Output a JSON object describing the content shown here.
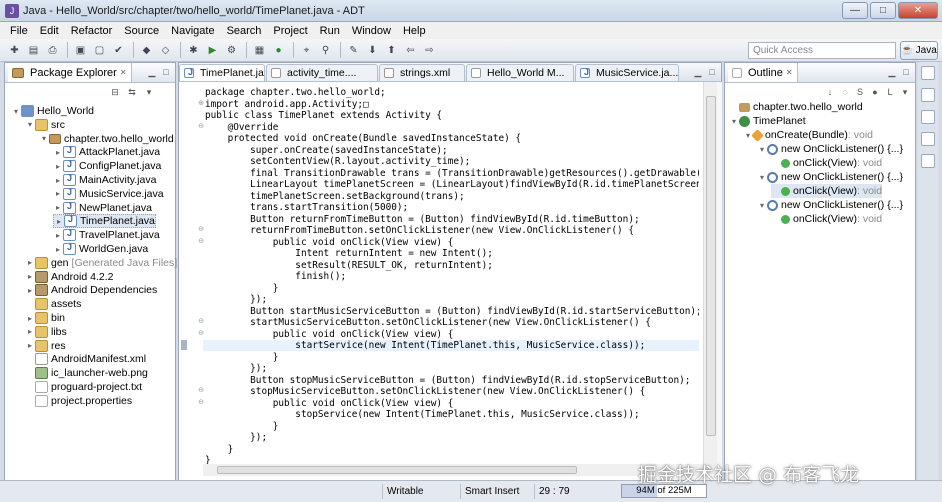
{
  "window": {
    "title": "Java - Hello_World/src/chapter/two/hello_world/TimePlanet.java - ADT",
    "buttons": [
      "—",
      "□",
      "✕"
    ]
  },
  "menu": [
    "File",
    "Edit",
    "Refactor",
    "Source",
    "Navigate",
    "Search",
    "Project",
    "Run",
    "Window",
    "Help"
  ],
  "toolbar": {
    "quick_access_placeholder": "Quick Access",
    "perspective": "Java"
  },
  "package_explorer": {
    "title": "Package Explorer",
    "items": [
      {
        "label": "Hello_World",
        "icon": "project-icon",
        "level": 0,
        "twist": "▾"
      },
      {
        "label": "src",
        "icon": "folder-icon",
        "level": 1,
        "twist": "▾"
      },
      {
        "label": "chapter.two.hello_world",
        "icon": "package-icon",
        "level": 2,
        "twist": "▾"
      },
      {
        "label": "AttackPlanet.java",
        "icon": "java-file-icon",
        "level": 3,
        "twist": "▸"
      },
      {
        "label": "ConfigPlanet.java",
        "icon": "java-file-icon",
        "level": 3,
        "twist": "▸"
      },
      {
        "label": "MainActivity.java",
        "icon": "java-file-icon",
        "level": 3,
        "twist": "▸"
      },
      {
        "label": "MusicService.java",
        "icon": "java-file-icon",
        "level": 3,
        "twist": "▸"
      },
      {
        "label": "NewPlanet.java",
        "icon": "java-file-icon",
        "level": 3,
        "twist": "▸"
      },
      {
        "label": "TimePlanet.java",
        "icon": "java-file-icon",
        "level": 3,
        "twist": "▸",
        "selected": true
      },
      {
        "label": "TravelPlanet.java",
        "icon": "java-file-icon",
        "level": 3,
        "twist": "▸"
      },
      {
        "label": "WorldGen.java",
        "icon": "java-file-icon",
        "level": 3,
        "twist": "▸"
      },
      {
        "label": "gen",
        "suffix": "[Generated Java Files]",
        "icon": "folder-icon",
        "level": 1,
        "twist": "▸"
      },
      {
        "label": "Android 4.2.2",
        "icon": "library-icon",
        "level": 1,
        "twist": "▸"
      },
      {
        "label": "Android Dependencies",
        "icon": "library-icon",
        "level": 1,
        "twist": "▸"
      },
      {
        "label": "assets",
        "icon": "folder-icon",
        "level": 1,
        "twist": ""
      },
      {
        "label": "bin",
        "icon": "folder-icon",
        "level": 1,
        "twist": "▸"
      },
      {
        "label": "libs",
        "icon": "folder-icon",
        "level": 1,
        "twist": "▸"
      },
      {
        "label": "res",
        "icon": "folder-icon",
        "level": 1,
        "twist": "▸"
      },
      {
        "label": "AndroidManifest.xml",
        "icon": "xml-file-icon",
        "level": 1,
        "twist": ""
      },
      {
        "label": "ic_launcher-web.png",
        "icon": "image-file-icon",
        "level": 1,
        "twist": ""
      },
      {
        "label": "proguard-project.txt",
        "icon": "text-file-icon",
        "level": 1,
        "twist": ""
      },
      {
        "label": "project.properties",
        "icon": "text-file-icon",
        "level": 1,
        "twist": ""
      }
    ]
  },
  "editor": {
    "tabs": [
      {
        "label": "TimePlanet.java",
        "active": true
      },
      {
        "label": "activity_time....",
        "active": false
      },
      {
        "label": "strings.xml",
        "active": false
      },
      {
        "label": "Hello_World M...",
        "active": false
      },
      {
        "label": "MusicService.ja...",
        "active": false
      }
    ],
    "lines": [
      "package chapter.two.hello_world;",
      "import android.app.Activity;□",
      "public class TimePlanet extends Activity {",
      "    @Override",
      "    protected void onCreate(Bundle savedInstanceState) {",
      "        super.onCreate(savedInstanceState);",
      "        setContentView(R.layout.activity_time);",
      "        final TransitionDrawable trans = (TransitionDrawable)getResources().getDrawable(R.dr",
      "        LinearLayout timePlanetScreen = (LinearLayout)findViewById(R.id.timePlanetScreen);",
      "        timePlanetScreen.setBackground(trans);",
      "        trans.startTransition(5000);",
      "        Button returnFromTimeButton = (Button) findViewById(R.id.timeButton);",
      "        returnFromTimeButton.setOnClickListener(new View.OnClickListener() {",
      "            public void onClick(View view) {",
      "                Intent returnIntent = new Intent();",
      "                setResult(RESULT_OK, returnIntent);",
      "                finish();",
      "            }",
      "        });",
      "        Button startMusicServiceButton = (Button) findViewById(R.id.startServiceButton);",
      "        startMusicServiceButton.setOnClickListener(new View.OnClickListener() {",
      "            public void onClick(View view) {",
      "                startService(new Intent(TimePlanet.this, MusicService.class));",
      "            }",
      "        });",
      "        Button stopMusicServiceButton = (Button) findViewById(R.id.stopServiceButton);",
      "        stopMusicServiceButton.setOnClickListener(new View.OnClickListener() {",
      "            public void onClick(View view) {",
      "                stopService(new Intent(TimePlanet.this, MusicService.class));",
      "            }",
      "        });",
      "    }",
      "}"
    ],
    "highlighted_line": 22
  },
  "outline": {
    "title": "Outline",
    "items": [
      {
        "label": "chapter.two.hello_world",
        "icon": "package-icon",
        "level": 0,
        "twist": ""
      },
      {
        "label": "TimePlanet",
        "icon": "class-icon",
        "level": 0,
        "twist": "▾"
      },
      {
        "label": "onCreate(Bundle)",
        "suffix": " : void",
        "icon": "protected-method-icon",
        "level": 1,
        "twist": "▾"
      },
      {
        "label": "new OnClickListener() {...}",
        "icon": "anonymous-class-icon",
        "level": 2,
        "twist": "▾"
      },
      {
        "label": "onClick(View)",
        "suffix": " : void",
        "icon": "method-icon",
        "level": 3,
        "twist": ""
      },
      {
        "label": "new OnClickListener() {...}",
        "icon": "anonymous-class-icon",
        "level": 2,
        "twist": "▾"
      },
      {
        "label": "onClick(View)",
        "suffix": " : void",
        "icon": "method-icon",
        "level": 3,
        "twist": "",
        "selected": true
      },
      {
        "label": "new OnClickListener() {...}",
        "icon": "anonymous-class-icon",
        "level": 2,
        "twist": "▾"
      },
      {
        "label": "onClick(View)",
        "suffix": " : void",
        "icon": "method-icon",
        "level": 3,
        "twist": ""
      }
    ]
  },
  "status": {
    "mode": "Writable",
    "insert": "Smart Insert",
    "position": "29 : 79",
    "memory": "94M of 225M",
    "memory_fraction": 0.42
  },
  "watermark": "掘金技术社区 @ 布客飞龙"
}
